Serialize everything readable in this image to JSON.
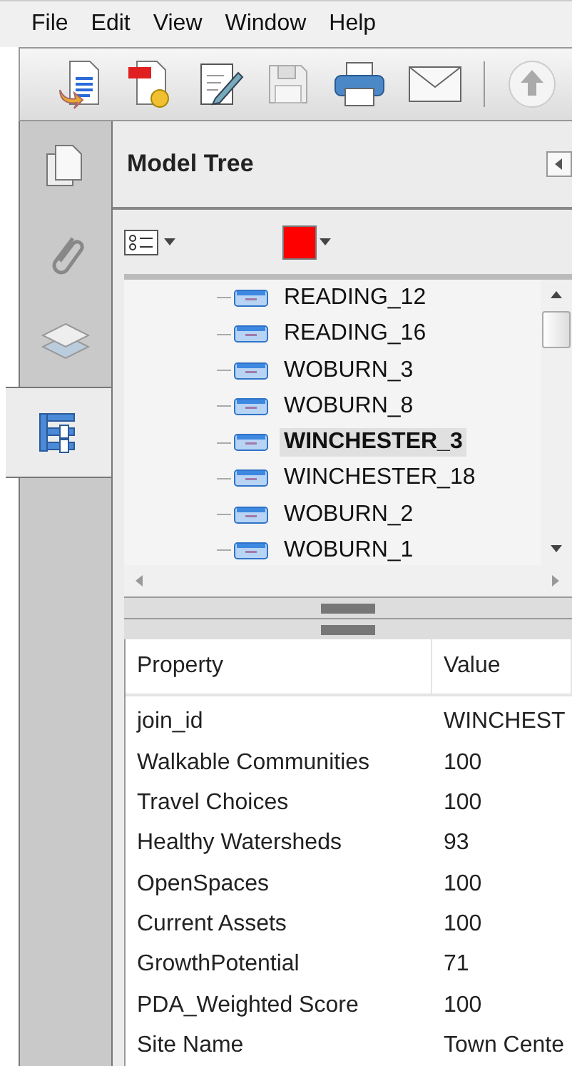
{
  "menu": [
    "File",
    "Edit",
    "View",
    "Window",
    "Help"
  ],
  "panel": {
    "title": "Model Tree"
  },
  "side_tabs": [
    {
      "kind": "pages",
      "selected": false
    },
    {
      "kind": "attachments",
      "selected": false
    },
    {
      "kind": "layers",
      "selected": false
    },
    {
      "kind": "tree",
      "selected": true
    }
  ],
  "tree": [
    {
      "label": "READING_12",
      "selected": false
    },
    {
      "label": "READING_16",
      "selected": false
    },
    {
      "label": "WOBURN_3",
      "selected": false
    },
    {
      "label": "WOBURN_8",
      "selected": false
    },
    {
      "label": "WINCHESTER_3",
      "selected": true
    },
    {
      "label": "WINCHESTER_18",
      "selected": false
    },
    {
      "label": "WOBURN_2",
      "selected": false
    },
    {
      "label": "WOBURN_1",
      "selected": false
    }
  ],
  "properties": {
    "columns": [
      "Property",
      "Value"
    ],
    "rows": [
      [
        "join_id",
        "WINCHEST"
      ],
      [
        "Walkable Communities",
        "100"
      ],
      [
        "Travel Choices",
        "100"
      ],
      [
        "Healthy Watersheds",
        "93"
      ],
      [
        "OpenSpaces",
        "100"
      ],
      [
        "Current Assets",
        "100"
      ],
      [
        "GrowthPotential",
        "71"
      ],
      [
        "PDA_Weighted Score",
        "100"
      ],
      [
        "Site Name",
        "Town Cente"
      ]
    ]
  }
}
